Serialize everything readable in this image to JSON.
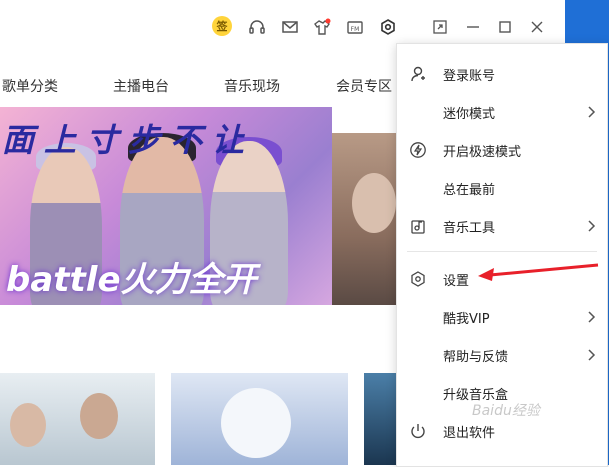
{
  "titlebar": {
    "sign_badge": "签",
    "icons": [
      "sign-in-badge",
      "headphones-icon",
      "mail-icon",
      "skin-icon",
      "fm-icon",
      "settings-hex-icon",
      "mini-window-icon",
      "minimize-icon",
      "maximize-icon",
      "close-icon"
    ],
    "fm_label": "FM",
    "notification_dot_color": "#ff3b30"
  },
  "nav": {
    "items": [
      "歌单分类",
      "主播电台",
      "音乐现场",
      "会员专区"
    ]
  },
  "banner": {
    "headline": "面上寸步不让",
    "tagline": "battle火力全开"
  },
  "menu": {
    "items": [
      {
        "label": "登录账号",
        "icon": "user-login-icon",
        "has_submenu": false
      },
      {
        "label": "迷你模式",
        "icon": "",
        "has_submenu": true
      },
      {
        "label": "开启极速模式",
        "icon": "lightning-icon",
        "has_submenu": false
      },
      {
        "label": "总在最前",
        "icon": "",
        "has_submenu": false
      },
      {
        "label": "音乐工具",
        "icon": "music-tool-icon",
        "has_submenu": true
      },
      {
        "label": "设置",
        "icon": "settings-hex-icon",
        "has_submenu": false
      },
      {
        "label": "酷我VIP",
        "icon": "",
        "has_submenu": true
      },
      {
        "label": "帮助与反馈",
        "icon": "",
        "has_submenu": true
      },
      {
        "label": "升级音乐盒",
        "icon": "",
        "has_submenu": false
      },
      {
        "label": "退出软件",
        "icon": "power-icon",
        "has_submenu": false
      }
    ]
  },
  "annotation": {
    "arrow_color": "#e8202a"
  },
  "watermark": "Baidu经验",
  "colors": {
    "accent_blue": "#1f6fd6",
    "sign_yellow": "#ffd43b"
  }
}
